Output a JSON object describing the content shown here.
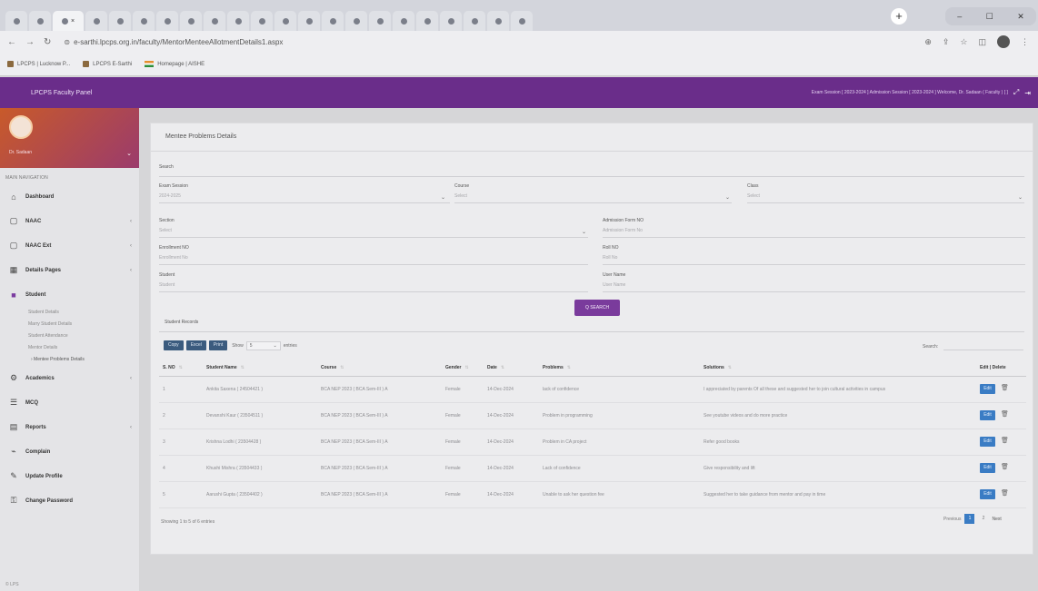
{
  "browser": {
    "url": "e-sarthi.lpcps.org.in/faculty/MentorMenteeAllotmentDetails1.aspx",
    "bookmarks": [
      "LPCPS | Lucknow P...",
      "LPCPS E-Sarthi",
      "Homepage | AISHE"
    ]
  },
  "app": {
    "brand": "LPCPS Faculty Panel",
    "header_right": "Exam Session [ 2023-2024 ]   Admission Session [ 2023-2024 ]   Welcome, Dr. Sadaan ( Faculty ) [ ]"
  },
  "sidebar": {
    "user": "Dr. Sadaan",
    "nav_heading": "MAIN NAVIGATION",
    "items": [
      {
        "label": "Dashboard",
        "icon": "home-icon",
        "expand": ""
      },
      {
        "label": "NAAC",
        "icon": "square-icon",
        "expand": "‹"
      },
      {
        "label": "NAAC Ext",
        "icon": "square-icon",
        "expand": "‹"
      },
      {
        "label": "Details Pages",
        "icon": "grid-icon",
        "expand": "‹"
      },
      {
        "label": "Student",
        "icon": "user-icon",
        "expand": ""
      }
    ],
    "sub_items": [
      "Student Details",
      "Marry Student Details",
      "Student Attendance",
      "Mentor Details"
    ],
    "current_sub": "› Mentee Problems Details",
    "items2": [
      {
        "label": "Academics",
        "icon": "gear-icon",
        "expand": "‹"
      },
      {
        "label": "MCQ",
        "icon": "list-icon",
        "expand": ""
      },
      {
        "label": "Reports",
        "icon": "chart-icon",
        "expand": "‹"
      },
      {
        "label": "Complain",
        "icon": "megaphone-icon",
        "expand": ""
      },
      {
        "label": "Update Profile",
        "icon": "user-edit-icon",
        "expand": ""
      },
      {
        "label": "Change Password",
        "icon": "key-icon",
        "expand": ""
      }
    ],
    "footer": "© LPS"
  },
  "page": {
    "title": "Mentee Problems Details",
    "search_label": "Search",
    "fields": {
      "exam_session": {
        "label": "Exam Session",
        "value": "2024-2025"
      },
      "course": {
        "label": "Course",
        "value": "Select"
      },
      "class": {
        "label": "Class",
        "value": "Select"
      },
      "section": {
        "label": "Section",
        "value": "Select"
      },
      "admission_form_no": {
        "label": "Admission Form NO",
        "value": "Admission Form No"
      },
      "enrollment_no": {
        "label": "Enrollment NO",
        "value": "Enrollment No"
      },
      "roll_no": {
        "label": "Roll NO",
        "value": "Roll No"
      },
      "student": {
        "label": "Student",
        "value": "Student"
      },
      "user_name": {
        "label": "User Name",
        "value": "User Name"
      }
    },
    "search_button": "Q SEARCH",
    "student_records_label": "Student Records",
    "buttons": {
      "copy": "Copy",
      "excel": "Excel",
      "print": "Print"
    },
    "show_label": "Show",
    "entries_value": "5",
    "entries_label": "entries",
    "table_search_label": "Search:",
    "columns": [
      "S. NO",
      "Student Name",
      "Course",
      "Gender",
      "Date",
      "Problems",
      "Solutions",
      "Edit | Delete"
    ],
    "edit_label": "Edit",
    "rows": [
      {
        "sno": "1",
        "name": "Ankita Saxena ( 24504421 )",
        "course": "BCA NEP 2023 ( BCA Sem-III ) A",
        "gender": "Female",
        "date": "14-Dec-2024",
        "problem": "lack of confidence",
        "solution": "I appreciated by parents Of all these and suggested her to join cultural activities in campus"
      },
      {
        "sno": "2",
        "name": "Devanshi Kaur ( 23504511 )",
        "course": "BCA NEP 2023 ( BCA Sem-III ) A",
        "gender": "Female",
        "date": "14-Dec-2024",
        "problem": "Problem in programming",
        "solution": "See youtube videos and do more practice"
      },
      {
        "sno": "3",
        "name": "Krishna Lodhi ( 23504428 )",
        "course": "BCA NEP 2023 ( BCA Sem-III ) A",
        "gender": "Female",
        "date": "14-Dec-2024",
        "problem": "Problem in CA project",
        "solution": "Refer good books"
      },
      {
        "sno": "4",
        "name": "Khushi Mishra ( 23504433 )",
        "course": "BCA NEP 2023 ( BCA Sem-III ) A",
        "gender": "Female",
        "date": "14-Dec-2024",
        "problem": "Lack of confidence",
        "solution": "Give responsibility and lift"
      },
      {
        "sno": "5",
        "name": "Aarushi Gupta ( 23504402 )",
        "course": "BCA NEP 2023 ( BCA Sem-III ) A",
        "gender": "Female",
        "date": "14-Dec-2024",
        "problem": "Unable to ask her question fee",
        "solution": "Suggested her to take guidance from mentor and pay in time"
      }
    ],
    "info": "Showing 1 to 5 of 6 entries",
    "pager": {
      "prev": "Previous",
      "pages": [
        "1",
        "2"
      ],
      "next": "Next"
    }
  }
}
